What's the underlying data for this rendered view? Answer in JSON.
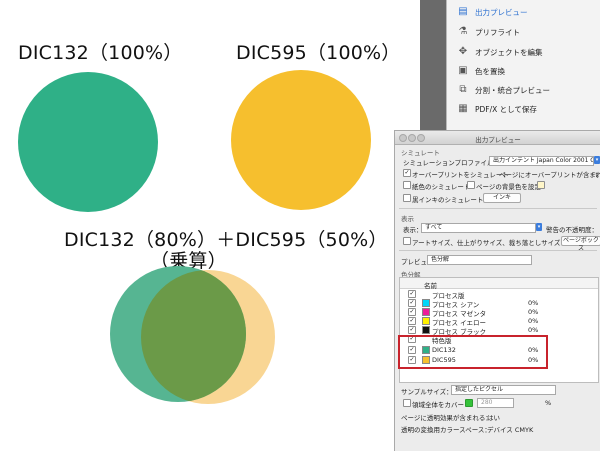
{
  "canvas": {
    "swatch1_label": "DIC132（100%）",
    "swatch2_label": "DIC595（100%）",
    "mix_label_line1": "DIC132（80%）＋DIC595（50%）",
    "mix_label_line2": "（乗算）",
    "colors": {
      "dic132": "#2fb087",
      "dic595": "#f6bf2e",
      "dic132_80": "#56b592",
      "dic595_50": "#f9d694",
      "multiply_overlap": "#6b9a48"
    }
  },
  "tools": [
    {
      "label": "出力プレビュー",
      "icon": "output-preview-icon",
      "selected": true
    },
    {
      "label": "プリフライト",
      "icon": "preflight-icon",
      "selected": false
    },
    {
      "label": "オブジェクトを編集",
      "icon": "edit-object-icon",
      "selected": false
    },
    {
      "label": "色を置換",
      "icon": "replace-color-icon",
      "selected": false
    },
    {
      "label": "分割・統合プレビュー",
      "icon": "flatten-preview-icon",
      "selected": false
    },
    {
      "label": "PDF/X として保存",
      "icon": "save-pdfx-icon",
      "selected": false
    }
  ],
  "panel": {
    "title": "出力プレビュー",
    "simulate_header": "シミュレート",
    "sim_profile_label": "シミュレーションプロファイル：",
    "sim_profile_value": "出力インテント  Japan Color 2001 Coated",
    "overprint_label": "オーバープリントをシミュレート",
    "page_overprint_label": "ページにオーバープリントが含まれる：",
    "page_overprint_value": "い",
    "paper_color_label": "紙色のシミュレート",
    "page_bg_label": "ページの背景色を設定",
    "black_ink_label": "黒インキのシミュレート",
    "ink_button": "インキ",
    "display_header": "表示",
    "display_label": "表示：",
    "display_value": "すべて",
    "warning_label": "警告の不透明度：",
    "artsize_label": "アートサイズ、仕上がりサイズ、裁ち落としサイズを表示",
    "page_box_button": "ページボックス",
    "preview_label": "プレビュー：",
    "preview_value": "色分解",
    "separation_header": "色分解",
    "table_name_header": "名前",
    "rows": [
      {
        "name": "プロセス版",
        "value": "",
        "color": ""
      },
      {
        "name": "プロセス シアン",
        "value": "0%",
        "color": "#00d8f8"
      },
      {
        "name": "プロセス マゼンタ",
        "value": "0%",
        "color": "#ee1c9a"
      },
      {
        "name": "プロセス イエロー",
        "value": "0%",
        "color": "#fff100"
      },
      {
        "name": "プロセス ブラック",
        "value": "0%",
        "color": "#111111"
      },
      {
        "name": "特色版",
        "value": "",
        "color": ""
      },
      {
        "name": "DIC132",
        "value": "0%",
        "color": "#2fb087"
      },
      {
        "name": "DIC595",
        "value": "0%",
        "color": "#f6bf2e"
      }
    ],
    "sample_size_label": "サンプルサイズ：",
    "sample_size_value": "指定したピクセル",
    "area_coverage_label": "領域全体をカバー",
    "area_coverage_value": "280",
    "area_coverage_unit": "%",
    "transparency_label": "ページに透明効果が含まれる：",
    "transparency_value": "はい",
    "blend_space_label": "透明の変換用カラースペース：",
    "blend_space_value": "デバイス CMYK",
    "highlight_color": "#c8232c"
  }
}
